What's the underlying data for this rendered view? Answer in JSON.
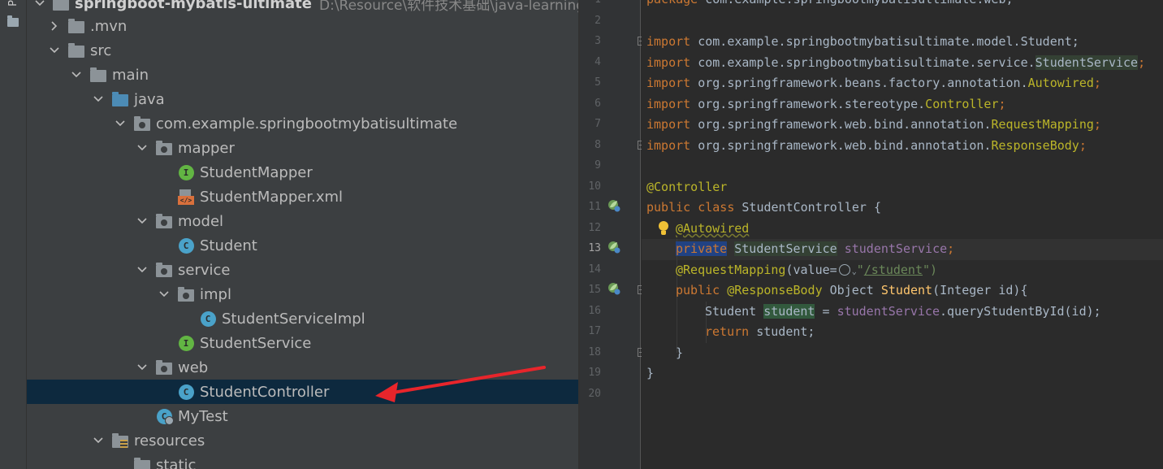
{
  "toolwindow": {
    "tab_label": "P"
  },
  "tree": {
    "root": {
      "name": "springboot-mybatis-ultimate",
      "path": "D:\\Resource\\软件技术基础\\java-learning"
    },
    "items": [
      {
        "label": ".mvn",
        "icon": "folder",
        "chevron": "right"
      },
      {
        "label": "src",
        "icon": "folder",
        "chevron": "down"
      },
      {
        "label": "main",
        "icon": "folder",
        "chevron": "down"
      },
      {
        "label": "java",
        "icon": "source-folder",
        "chevron": "down"
      },
      {
        "label": "com.example.springbootmybatisultimate",
        "icon": "package",
        "chevron": "down"
      },
      {
        "label": "mapper",
        "icon": "package",
        "chevron": "down"
      },
      {
        "label": "StudentMapper",
        "icon": "interface",
        "chevron": "none"
      },
      {
        "label": "StudentMapper.xml",
        "icon": "xml",
        "chevron": "none"
      },
      {
        "label": "model",
        "icon": "package",
        "chevron": "down"
      },
      {
        "label": "Student",
        "icon": "class",
        "chevron": "none"
      },
      {
        "label": "service",
        "icon": "package",
        "chevron": "down"
      },
      {
        "label": "impl",
        "icon": "package",
        "chevron": "down"
      },
      {
        "label": "StudentServiceImpl",
        "icon": "class",
        "chevron": "none"
      },
      {
        "label": "StudentService",
        "icon": "interface",
        "chevron": "none"
      },
      {
        "label": "web",
        "icon": "package",
        "chevron": "down"
      },
      {
        "label": "StudentController",
        "icon": "class",
        "chevron": "none",
        "selected": true
      },
      {
        "label": "MyTest",
        "icon": "test-class",
        "chevron": "none"
      },
      {
        "label": "resources",
        "icon": "resources-folder",
        "chevron": "down"
      },
      {
        "label": "static",
        "icon": "folder",
        "chevron": "none"
      }
    ]
  },
  "editor": {
    "current_line": 13,
    "line_numbers": [
      "1",
      "2",
      "3",
      "4",
      "5",
      "6",
      "7",
      "8",
      "9",
      "10",
      "11",
      "12",
      "13",
      "14",
      "15",
      "16",
      "17",
      "18",
      "19",
      "20"
    ],
    "code": {
      "l1": {
        "kw": "package",
        "rest": " com.example.springbootmybatisultimate.web;"
      },
      "l3": {
        "kw": "import",
        "rest": " com.example.springbootmybatisultimate.model.Student;"
      },
      "l4": {
        "kw": "import",
        "pre": " com.example.springbootmybatisultimate.service.",
        "hl": "StudentService",
        "post": ";"
      },
      "l5": {
        "kw": "import",
        "pre": " org.springframework.beans.factory.annotation.",
        "ann": "Autowired",
        "post": ";"
      },
      "l6": {
        "kw": "import",
        "pre": " org.springframework.stereotype.",
        "ann": "Controller",
        "post": ";"
      },
      "l7": {
        "kw": "import",
        "pre": " org.springframework.web.bind.annotation.",
        "ann": "RequestMapping",
        "post": ";"
      },
      "l8": {
        "kw": "import",
        "pre": " org.springframework.web.bind.annotation.",
        "ann": "ResponseBody",
        "post": ";"
      },
      "l10": {
        "ann": "@Controller"
      },
      "l11": {
        "kw1": "public",
        "kw2": "class",
        "name": " StudentController {"
      },
      "l12": {
        "ann": "@Autowired"
      },
      "l13": {
        "kw": "private",
        "type": "StudentService",
        "field": "studentService",
        "semi": ";"
      },
      "l14": {
        "ann": "@RequestMapping",
        "open": "(value=",
        "q1": "\"",
        "str": "/student",
        "close": "\")"
      },
      "l15": {
        "kw": "public",
        "ann": "@ResponseBody",
        "type": " Object ",
        "fn": "Student",
        "params": "(Integer id){"
      },
      "l16": {
        "type": "Student ",
        "var": "student",
        "eq": " = ",
        "field": "studentService",
        "call": ".queryStudentById(id);"
      },
      "l17": {
        "kw": "return",
        "rest": " student;"
      },
      "l18": {
        "rest": "}"
      },
      "l19": {
        "rest": "}"
      }
    }
  },
  "colors": {
    "tree_bg": "#3c3f41",
    "selected_row": "#0d293e",
    "editor_bg": "#2b2b2b",
    "keyword": "#cc7832",
    "annotation": "#bbb529",
    "field": "#9876aa",
    "string": "#6a8759",
    "function": "#ffc66d",
    "arrow": "#e8252b"
  }
}
